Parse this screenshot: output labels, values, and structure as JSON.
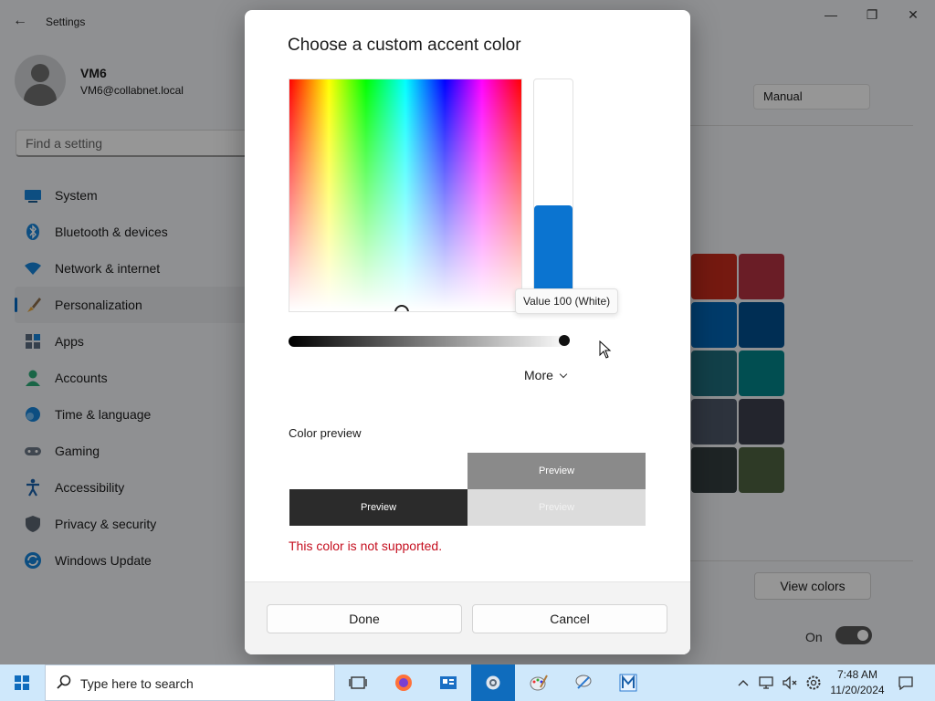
{
  "window": {
    "app_title": "Settings",
    "back_glyph": "←",
    "controls": [
      "—",
      "❐",
      "✕"
    ]
  },
  "profile": {
    "name": "VM6",
    "email": "VM6@collabnet.local"
  },
  "search": {
    "placeholder": "Find a setting"
  },
  "nav": {
    "items": [
      {
        "label": "System",
        "icon": "system-icon"
      },
      {
        "label": "Bluetooth & devices",
        "icon": "bluetooth-icon"
      },
      {
        "label": "Network & internet",
        "icon": "network-icon"
      },
      {
        "label": "Personalization",
        "icon": "personalization-icon",
        "active": true
      },
      {
        "label": "Apps",
        "icon": "apps-icon"
      },
      {
        "label": "Accounts",
        "icon": "accounts-icon"
      },
      {
        "label": "Time & language",
        "icon": "time-language-icon"
      },
      {
        "label": "Gaming",
        "icon": "gaming-icon"
      },
      {
        "label": "Accessibility",
        "icon": "accessibility-icon"
      },
      {
        "label": "Privacy & security",
        "icon": "privacy-icon"
      },
      {
        "label": "Windows Update",
        "icon": "windows-update-icon"
      }
    ]
  },
  "right_pane": {
    "dropdown_value": "Manual",
    "swatch_colors": [
      [
        "#c42b1c",
        "#b13140"
      ],
      [
        "#0063b1",
        "#004e8c"
      ],
      [
        "#1f6b7a",
        "#038387"
      ],
      [
        "#4c5666",
        "#3b3f4c"
      ],
      [
        "#333c3f",
        "#4d6240"
      ]
    ],
    "view_colors_label": "View colors",
    "toggle_label": "On",
    "toggle_state": "on"
  },
  "dialog": {
    "title": "Choose a custom accent color",
    "value_tooltip": "Value 100 (White)",
    "value_bar_fill_fraction": 0.42,
    "value_slider_level": 1.0,
    "value_bar_color": "#0b74d0",
    "more_label": "More",
    "color_preview_label": "Color preview",
    "preview_text": "Preview",
    "preview_colors": {
      "top_right": "#8a8a8a",
      "bottom_left": "#2b2b2b",
      "bottom_right": "#dcdcdc"
    },
    "error_text": "This color is not supported.",
    "error_color": "#c50f1f",
    "done_label": "Done",
    "cancel_label": "Cancel"
  },
  "taskbar": {
    "search_placeholder": "Type here to search",
    "apps": [
      "task-view-icon",
      "firefox-icon",
      "file-explorer-icon",
      "settings-app-icon",
      "paint-icon",
      "app-icon",
      "m-app-icon"
    ],
    "active_app": "settings-app-icon",
    "time": "7:48 AM",
    "date": "11/20/2024",
    "accent": "#0f6cbd"
  }
}
